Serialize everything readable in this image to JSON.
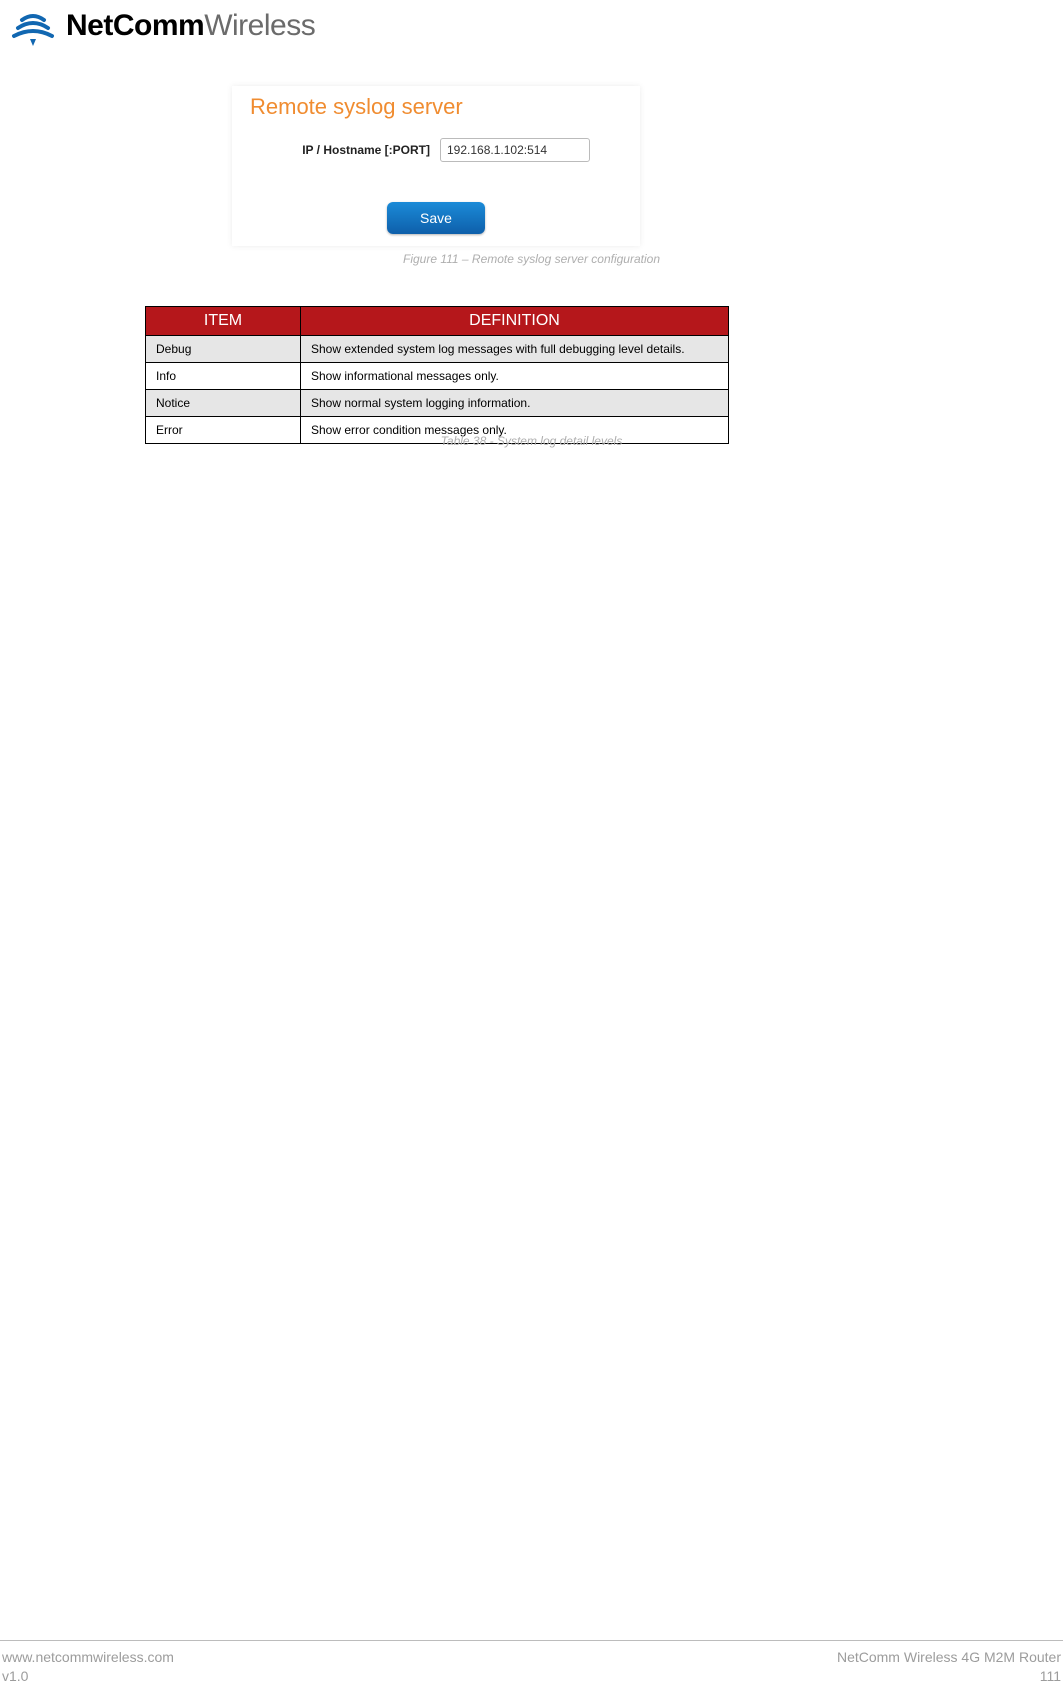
{
  "brand": {
    "bold": "NetComm",
    "light": "Wireless"
  },
  "syslog_panel": {
    "title": "Remote syslog server",
    "field_label": "IP / Hostname [:PORT]",
    "field_value": "192.168.1.102:514",
    "save_label": "Save"
  },
  "figure_caption": "Figure 111 – Remote syslog server configuration",
  "table_caption": "Table 38 - System log detail levels",
  "table": {
    "header": {
      "item": "ITEM",
      "definition": "DEFINITION"
    },
    "rows": [
      {
        "item": "Debug",
        "definition": "Show extended system log messages with full debugging level details."
      },
      {
        "item": "Info",
        "definition": "Show informational messages only."
      },
      {
        "item": "Notice",
        "definition": "Show normal system logging information."
      },
      {
        "item": "Error",
        "definition": "Show error condition messages only."
      }
    ]
  },
  "footer": {
    "url": "www.netcommwireless.com",
    "version": "v1.0",
    "product": "NetComm Wireless 4G M2M Router",
    "page": "111"
  }
}
